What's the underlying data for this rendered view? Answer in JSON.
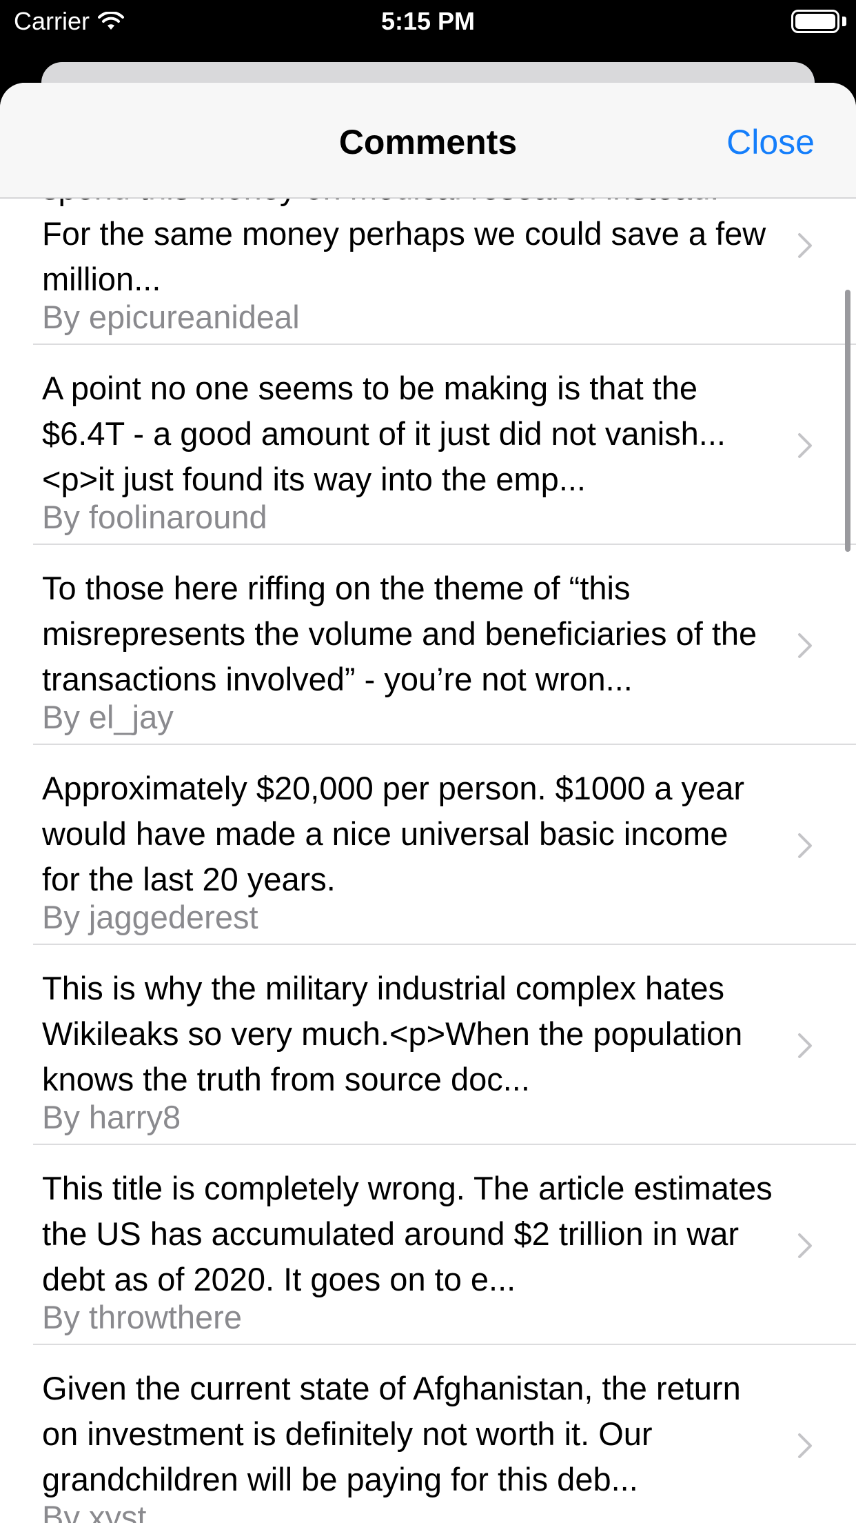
{
  "status_bar": {
    "carrier": "Carrier",
    "time": "5:15 PM",
    "icons": [
      "wifi-icon",
      "battery-icon"
    ]
  },
  "nav": {
    "title": "Comments",
    "close_label": "Close"
  },
  "comments": [
    {
      "text": "spend this money on medical research instead.  For the same money perhaps we could save a few million...",
      "author": "By epicureanideal"
    },
    {
      "text": "A point no one seems to be making is that the $6.4T - a good amount of it just did not vanish...<p>it just found its way into the emp...",
      "author": "By foolinaround"
    },
    {
      "text": "To those here riffing on the theme of “this misrepresents the volume and beneficiaries of the transactions involved” - you’re not wron...",
      "author": "By el_jay"
    },
    {
      "text": "Approximately $20,000 per person. $1000 a year would have made a nice universal basic income for the last 20 years.",
      "author": "By jaggederest"
    },
    {
      "text": "This is why the military industrial complex hates Wikileaks so very much.<p>When the population knows the truth from source doc...",
      "author": "By harry8"
    },
    {
      "text": "This title is completely wrong. The article estimates the US has accumulated around $2 trillion in war debt as of 2020. It goes on to e...",
      "author": "By throwthere"
    },
    {
      "text": "Given the current state of Afghanistan, the return on investment is definitely not worth it. Our grandchildren will be paying for this deb...",
      "author": "By xyst"
    }
  ],
  "colors": {
    "accent": "#147efb",
    "secondary_text": "#8a8a8e",
    "separator": "#dcdcde"
  }
}
